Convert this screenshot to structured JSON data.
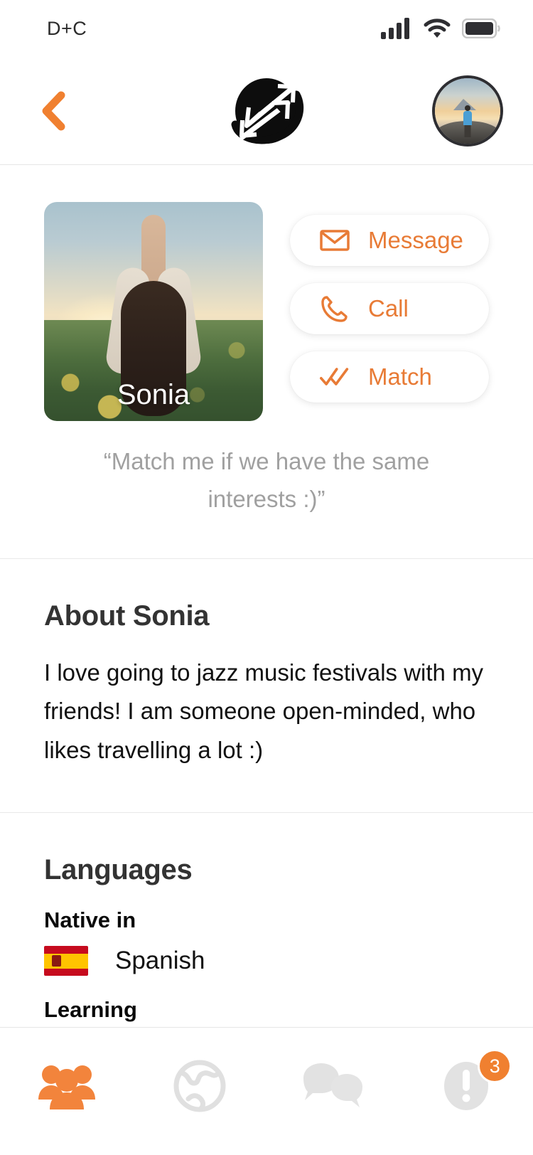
{
  "status_bar": {
    "carrier": "D+C",
    "signal_icon": "cellular-signal-icon",
    "wifi_icon": "wifi-icon",
    "battery_icon": "battery-full-icon"
  },
  "header": {
    "back_icon": "chevron-left-icon",
    "logo_icon": "app-logo-exchange-arrows-icon",
    "avatar_label": "user-avatar"
  },
  "profile": {
    "name": "Sonia",
    "photo_alt": "woman-raising-arms-in-sunflower-field",
    "quote": "“Match me if we have the same interests :)”",
    "actions": [
      {
        "label": "Message",
        "icon": "envelope-icon"
      },
      {
        "label": "Call",
        "icon": "phone-icon"
      },
      {
        "label": "Match",
        "icon": "double-check-icon"
      }
    ]
  },
  "about": {
    "title": "About Sonia",
    "text": "I love going to jazz music festivals with my friends! I am someone open-minded, who likes travelling a lot :)"
  },
  "languages": {
    "title": "Languages",
    "native_label": "Native in",
    "native": [
      {
        "language": "Spanish",
        "flag": "spain-flag-icon"
      }
    ],
    "learning_label": "Learning"
  },
  "bottom_nav": [
    {
      "name": "community",
      "icon": "people-group-icon",
      "active": true,
      "badge": ""
    },
    {
      "name": "explore",
      "icon": "globe-icon",
      "active": false,
      "badge": ""
    },
    {
      "name": "chats",
      "icon": "chat-bubbles-icon",
      "active": false,
      "badge": ""
    },
    {
      "name": "notifications",
      "icon": "alert-circle-icon",
      "active": false,
      "badge": "3"
    }
  ],
  "colors": {
    "accent": "#E87B36",
    "badge": "#F08030",
    "nav_inactive": "#E0E0E0",
    "text_dark": "#111111",
    "text_muted": "#A0A0A0",
    "divider": "#E9E9E9"
  }
}
